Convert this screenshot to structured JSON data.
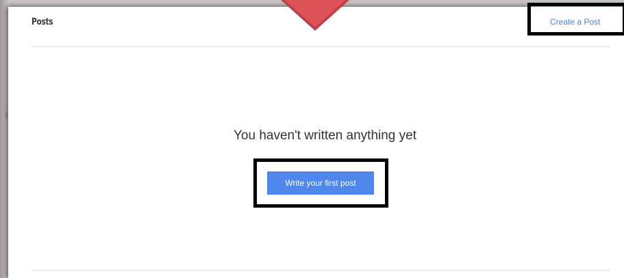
{
  "header": {
    "title": "Posts",
    "create_link_label": "Create a Post"
  },
  "empty_state": {
    "message": "You haven't written anything yet",
    "button_label": "Write your first post"
  },
  "colors": {
    "accent": "#4f86ec",
    "link": "#4a7fe0",
    "highlight_border": "#000000",
    "pointer_arrow": "#e0525a"
  },
  "annotations": {
    "pointer_icon": "down-arrow-marker"
  }
}
